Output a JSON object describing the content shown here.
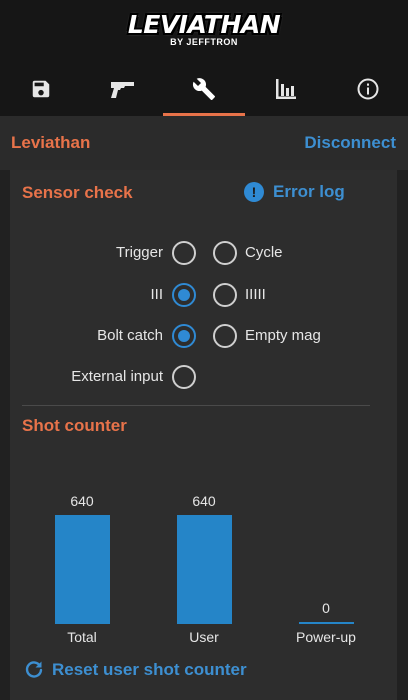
{
  "app": {
    "logo_main": "LEVIATHAN",
    "logo_sub": "BY JEFFTRON"
  },
  "tabs": [
    {
      "icon": "save-icon",
      "active": false
    },
    {
      "icon": "gun-icon",
      "active": false
    },
    {
      "icon": "wrench-icon",
      "active": true
    },
    {
      "icon": "bar-chart-icon",
      "active": false
    },
    {
      "icon": "info-icon",
      "active": false
    }
  ],
  "device": {
    "name": "Leviathan",
    "disconnect_label": "Disconnect"
  },
  "sensor_check": {
    "title": "Sensor check",
    "error_log_label": "Error log",
    "sensors": [
      {
        "label": "Trigger",
        "on": false
      },
      {
        "label": "Cycle",
        "on": false
      },
      {
        "label": "III",
        "on": true
      },
      {
        "label": "IIIII",
        "on": false
      },
      {
        "label": "Bolt catch",
        "on": true
      },
      {
        "label": "Empty mag",
        "on": false
      },
      {
        "label": "External input",
        "on": false
      }
    ]
  },
  "shot_counter": {
    "title": "Shot counter",
    "reset_label": "Reset user shot counter"
  },
  "chart_data": {
    "type": "bar",
    "categories": [
      "Total",
      "User",
      "Power-up"
    ],
    "values": [
      640,
      640,
      0
    ],
    "value_labels": [
      "640",
      "640",
      "0"
    ],
    "title": "",
    "xlabel": "",
    "ylabel": "",
    "ylim": [
      0,
      640
    ],
    "grid": false,
    "bar_color": "#2585c8"
  },
  "colors": {
    "accent_orange": "#e8734a",
    "accent_blue": "#3d8fd1",
    "background": "#212121",
    "panel": "#2d2d2d"
  }
}
